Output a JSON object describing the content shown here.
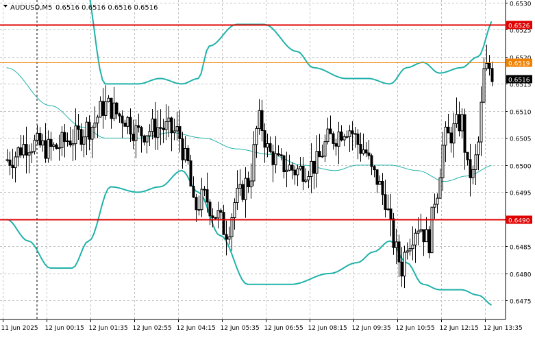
{
  "header": {
    "symbol_timeframe": "AUDUSD,M5",
    "ohlc_text": "0.6516 0.6516 0.6516 0.6516",
    "dropdown_icon": "triangle-down-icon"
  },
  "colors": {
    "background": "#ffffff",
    "grid": "#c0c0c0",
    "candle": "#000000",
    "bollinger": "#20b2aa",
    "level_red": "#e00000",
    "level_orange": "#f08000",
    "current_price_bg": "#000000"
  },
  "chart_data": {
    "type": "candlestick",
    "symbol": "AUDUSD",
    "timeframe": "M5",
    "title": "AUDUSD,M5",
    "ylim": [
      0.64715,
      0.65305
    ],
    "y_ticks": [
      "0.6530",
      "0.6525",
      "0.6520",
      "0.6515",
      "0.6510",
      "0.6505",
      "0.6500",
      "0.6495",
      "0.6490",
      "0.6485",
      "0.6480",
      "0.6475"
    ],
    "y_tick_values": [
      0.653,
      0.6525,
      0.652,
      0.6515,
      0.651,
      0.6505,
      0.65,
      0.6495,
      0.649,
      0.6485,
      0.648,
      0.6475
    ],
    "x_ticks": [
      "11 Jun 2025",
      "12 Jun 00:15",
      "12 Jun 01:35",
      "12 Jun 02:55",
      "12 Jun 04:15",
      "12 Jun 05:35",
      "12 Jun 06:55",
      "12 Jun 08:15",
      "12 Jun 09:35",
      "12 Jun 10:55",
      "12 Jun 12:15",
      "12 Jun 13:35"
    ],
    "x_tick_index": [
      0,
      16,
      32,
      48,
      64,
      80,
      96,
      112,
      128,
      144,
      160,
      176
    ],
    "bar_count": 178,
    "levels": [
      {
        "label": "0.6526",
        "value": 0.6526,
        "color": "red"
      },
      {
        "label": "0.6519",
        "value": 0.6519,
        "color": "orange"
      },
      {
        "label": "0.6490",
        "value": 0.649,
        "color": "red"
      }
    ],
    "current_price": {
      "label": "0.6516",
      "value": 0.6516
    },
    "bollinger_anchors": {
      "upper": [
        [
          0,
          0.6545
        ],
        [
          28,
          0.6535
        ],
        [
          36,
          0.6515
        ],
        [
          48,
          0.6515
        ],
        [
          56,
          0.6516
        ],
        [
          64,
          0.6515
        ],
        [
          70,
          0.6516
        ],
        [
          74,
          0.6522
        ],
        [
          84,
          0.6526
        ],
        [
          94,
          0.6526
        ],
        [
          106,
          0.6521
        ],
        [
          112,
          0.6518
        ],
        [
          124,
          0.6516
        ],
        [
          132,
          0.6516
        ],
        [
          140,
          0.6515
        ],
        [
          146,
          0.6518
        ],
        [
          152,
          0.6519
        ],
        [
          158,
          0.6517
        ],
        [
          166,
          0.6518
        ],
        [
          172,
          0.652
        ],
        [
          178,
          0.6527
        ]
      ],
      "middle": [
        [
          0,
          0.6518
        ],
        [
          16,
          0.6511
        ],
        [
          28,
          0.6507
        ],
        [
          36,
          0.6505
        ],
        [
          48,
          0.6505
        ],
        [
          60,
          0.6506
        ],
        [
          72,
          0.6505
        ],
        [
          84,
          0.6503
        ],
        [
          96,
          0.6502
        ],
        [
          108,
          0.65
        ],
        [
          120,
          0.6499
        ],
        [
          128,
          0.65
        ],
        [
          140,
          0.65
        ],
        [
          150,
          0.6499
        ],
        [
          160,
          0.6497
        ],
        [
          168,
          0.6498
        ],
        [
          178,
          0.65
        ]
      ],
      "lower": [
        [
          0,
          0.649
        ],
        [
          8,
          0.6486
        ],
        [
          16,
          0.6481
        ],
        [
          24,
          0.6481
        ],
        [
          30,
          0.6486
        ],
        [
          38,
          0.6496
        ],
        [
          48,
          0.6495
        ],
        [
          56,
          0.6496
        ],
        [
          64,
          0.6499
        ],
        [
          70,
          0.6495
        ],
        [
          78,
          0.6487
        ],
        [
          88,
          0.6478
        ],
        [
          104,
          0.6478
        ],
        [
          118,
          0.648
        ],
        [
          128,
          0.6482
        ],
        [
          134,
          0.6484
        ],
        [
          140,
          0.6486
        ],
        [
          146,
          0.6482
        ],
        [
          152,
          0.6478
        ],
        [
          158,
          0.6477
        ],
        [
          166,
          0.6477
        ],
        [
          172,
          0.6476
        ],
        [
          178,
          0.6474
        ]
      ]
    },
    "close_anchors": [
      [
        0,
        0.6501
      ],
      [
        8,
        0.6504
      ],
      [
        16,
        0.6503
      ],
      [
        24,
        0.6505
      ],
      [
        30,
        0.6507
      ],
      [
        36,
        0.6511
      ],
      [
        42,
        0.6509
      ],
      [
        48,
        0.6506
      ],
      [
        56,
        0.6507
      ],
      [
        62,
        0.6506
      ],
      [
        66,
        0.65
      ],
      [
        68,
        0.6492
      ],
      [
        72,
        0.6494
      ],
      [
        76,
        0.6491
      ],
      [
        80,
        0.6488
      ],
      [
        84,
        0.6494
      ],
      [
        88,
        0.6497
      ],
      [
        92,
        0.6508
      ],
      [
        96,
        0.6502
      ],
      [
        100,
        0.65
      ],
      [
        106,
        0.6499
      ],
      [
        112,
        0.65
      ],
      [
        118,
        0.6505
      ],
      [
        124,
        0.6507
      ],
      [
        130,
        0.6503
      ],
      [
        134,
        0.6498
      ],
      [
        138,
        0.6494
      ],
      [
        140,
        0.6488
      ],
      [
        142,
        0.6484
      ],
      [
        144,
        0.6481
      ],
      [
        146,
        0.6486
      ],
      [
        150,
        0.6489
      ],
      [
        154,
        0.6486
      ],
      [
        156,
        0.6494
      ],
      [
        160,
        0.6505
      ],
      [
        166,
        0.6508
      ],
      [
        168,
        0.6499
      ],
      [
        170,
        0.6498
      ],
      [
        172,
        0.6504
      ],
      [
        174,
        0.6517
      ],
      [
        176,
        0.6518
      ],
      [
        178,
        0.6516
      ]
    ]
  }
}
